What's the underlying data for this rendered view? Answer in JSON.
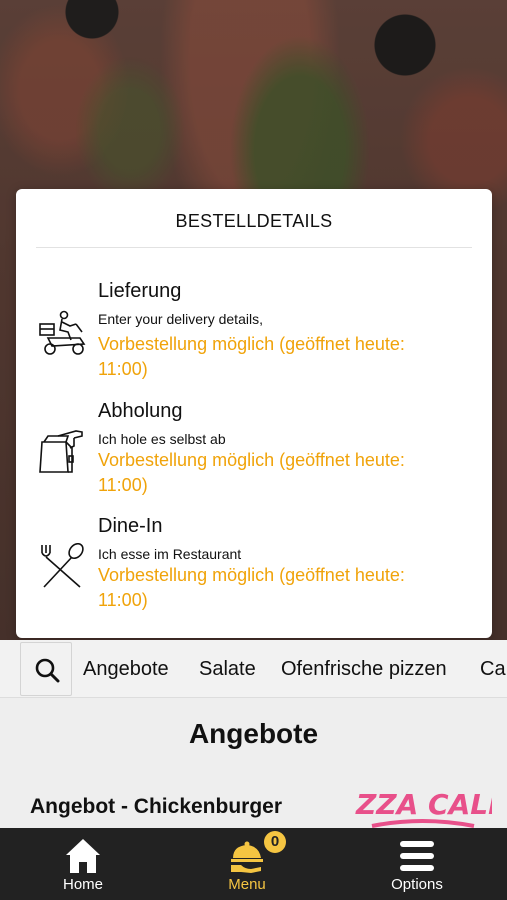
{
  "modal": {
    "title": "BESTELLDETAILS",
    "options": [
      {
        "title": "Lieferung",
        "description": "Enter your delivery details,",
        "status_line1": "Vorbestellung möglich (geöffnet heute:",
        "status_line2": "11:00)",
        "icon": "scooter-delivery-icon"
      },
      {
        "title": "Abholung",
        "description": "Ich hole es selbst ab",
        "status_line1": "Vorbestellung möglich (geöffnet heute:",
        "status_line2": "11:00)",
        "icon": "takeaway-bag-icon"
      },
      {
        "title": "Dine-In",
        "description": "Ich esse im Restaurant",
        "status_line1": "Vorbestellung möglich (geöffnet heute:",
        "status_line2": "11:00)",
        "icon": "fork-spoon-icon"
      }
    ]
  },
  "categories": {
    "search_icon": "search-icon",
    "items": [
      "Angebote",
      "Salate",
      "Ofenfrische pizzen",
      "Ca"
    ]
  },
  "content": {
    "section_title": "Angebote",
    "product_title": "Angebot - Chickenburger",
    "logo_text": "ZZA CALL"
  },
  "bottom_nav": {
    "items": [
      {
        "label": "Home",
        "icon": "home-icon"
      },
      {
        "label": "Menu",
        "icon": "cloche-icon",
        "badge": "0"
      },
      {
        "label": "Options",
        "icon": "menu-lines-icon"
      }
    ]
  },
  "colors": {
    "accent": "#f0a30a",
    "nav_active": "#f5c542",
    "nav_background": "#222222"
  }
}
